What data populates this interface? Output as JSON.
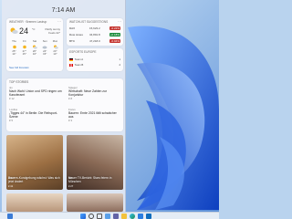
{
  "clock": {
    "time": "7:14 AM"
  },
  "weather": {
    "header": "WEATHER · Bremen Lastrup",
    "temp": "24",
    "unit": "°C",
    "info": [
      "Partly sunny",
      "Feels 22°"
    ],
    "days": [
      {
        "name": "Thu",
        "hi": "25°",
        "lo": "14°"
      },
      {
        "name": "Fri",
        "hi": "27°",
        "lo": "15°"
      },
      {
        "name": "Sat",
        "hi": "26°",
        "lo": "16°"
      },
      {
        "name": "Sun",
        "hi": "24°",
        "lo": "15°"
      },
      {
        "name": "Mon",
        "hi": "23°",
        "lo": "13°"
      }
    ],
    "link": "See full forecast"
  },
  "watchlist": {
    "header": "WATCHLIST SUGGESTIONS",
    "rows": [
      {
        "name": "DAX",
        "price": "15,623.2",
        "change": "-0.22%",
        "dir": "down"
      },
      {
        "name": "Dow Jones",
        "price": "34,891.8",
        "change": "+0.18%",
        "dir": "up"
      },
      {
        "name": "BTC",
        "price": "47,218.0",
        "change": "-0.94%",
        "dir": "down"
      }
    ]
  },
  "esports": {
    "header": "ESPORTS EUROPE",
    "rows": [
      {
        "team": "Team A",
        "score": "1"
      },
      {
        "team": "Team B",
        "score": "2"
      }
    ]
  },
  "news": {
    "header": "TOP STORIES",
    "stories": [
      {
        "source": "ntv",
        "title": "Nach Wahl: Union und SPD ringen um Kanzleramt",
        "reactions": "♥ 12"
      },
      {
        "source": "Spiegel",
        "title": "Wirtschaft: Neue Zahlen zur Konjunktur",
        "reactions": "♥ 8"
      },
      {
        "source": "t-online",
        "title": "„Tigges 44\" in Berlin: Die Reitsport-Szene",
        "reactions": "♥ 5"
      },
      {
        "source": "Focus",
        "title": "Bauern: Ernte 2021 fällt schwächer aus",
        "reactions": "♥ 3"
      }
    ],
    "cards": [
      {
        "source": "WELT",
        "title": "Bauern-Kundgebung wächst: Was sich jetzt ändert",
        "reactions": "♥ 41"
      },
      {
        "source": "Bild",
        "title": "Neuer TV-Bericht: Stars feiern in München",
        "reactions": "♥ 27"
      }
    ]
  },
  "colors": {
    "accent": "#2a6fc4",
    "up": "#1a8c3a",
    "down": "#c4322d"
  }
}
